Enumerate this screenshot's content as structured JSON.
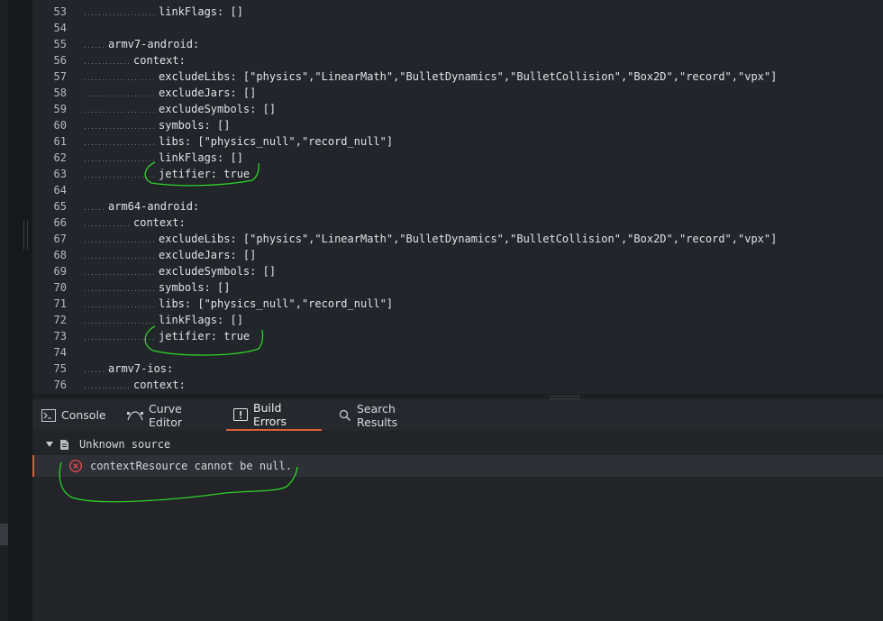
{
  "editor": {
    "lines": [
      {
        "num": "53",
        "indent": 3,
        "text": "linkFlags: []"
      },
      {
        "num": "54",
        "indent": 0,
        "text": ""
      },
      {
        "num": "55",
        "indent": 1,
        "text": "armv7-android:"
      },
      {
        "num": "56",
        "indent": 2,
        "text": "context:"
      },
      {
        "num": "57",
        "indent": 3,
        "text": "excludeLibs: [\"physics\",\"LinearMath\",\"BulletDynamics\",\"BulletCollision\",\"Box2D\",\"record\",\"vpx\"]"
      },
      {
        "num": "58",
        "indent": 3,
        "text": "excludeJars: []"
      },
      {
        "num": "59",
        "indent": 3,
        "text": "excludeSymbols: []"
      },
      {
        "num": "60",
        "indent": 3,
        "text": "symbols: []"
      },
      {
        "num": "61",
        "indent": 3,
        "text": "libs: [\"physics_null\",\"record_null\"]"
      },
      {
        "num": "62",
        "indent": 3,
        "text": "linkFlags: []"
      },
      {
        "num": "63",
        "indent": 3,
        "text": "jetifier: true"
      },
      {
        "num": "64",
        "indent": 0,
        "text": ""
      },
      {
        "num": "65",
        "indent": 1,
        "text": "arm64-android:"
      },
      {
        "num": "66",
        "indent": 2,
        "text": "context:"
      },
      {
        "num": "67",
        "indent": 3,
        "text": "excludeLibs: [\"physics\",\"LinearMath\",\"BulletDynamics\",\"BulletCollision\",\"Box2D\",\"record\",\"vpx\"]"
      },
      {
        "num": "68",
        "indent": 3,
        "text": "excludeJars: []"
      },
      {
        "num": "69",
        "indent": 3,
        "text": "excludeSymbols: []"
      },
      {
        "num": "70",
        "indent": 3,
        "text": "symbols: []"
      },
      {
        "num": "71",
        "indent": 3,
        "text": "libs: [\"physics_null\",\"record_null\"]"
      },
      {
        "num": "72",
        "indent": 3,
        "text": "linkFlags: []"
      },
      {
        "num": "73",
        "indent": 3,
        "text": "jetifier: true"
      },
      {
        "num": "74",
        "indent": 0,
        "text": ""
      },
      {
        "num": "75",
        "indent": 1,
        "text": "armv7-ios:"
      },
      {
        "num": "76",
        "indent": 2,
        "text": "context:"
      }
    ]
  },
  "tabs": [
    {
      "label": "Console",
      "icon": "terminal-icon",
      "active": false
    },
    {
      "label": "Curve Editor",
      "icon": "curve-icon",
      "active": false
    },
    {
      "label": "Build Errors",
      "icon": "warning-icon",
      "active": true
    },
    {
      "label": "Search Results",
      "icon": "search-icon",
      "active": false
    }
  ],
  "build_errors": {
    "source_label": "Unknown source",
    "source_icon": "file-icon",
    "expand_icon": "triangle-down-icon",
    "error_icon": "error-circle-icon",
    "message": "contextResource cannot be null."
  },
  "colors": {
    "accent": "#e05d3a",
    "error": "#e0474e",
    "annotation": "#2fd12a"
  }
}
